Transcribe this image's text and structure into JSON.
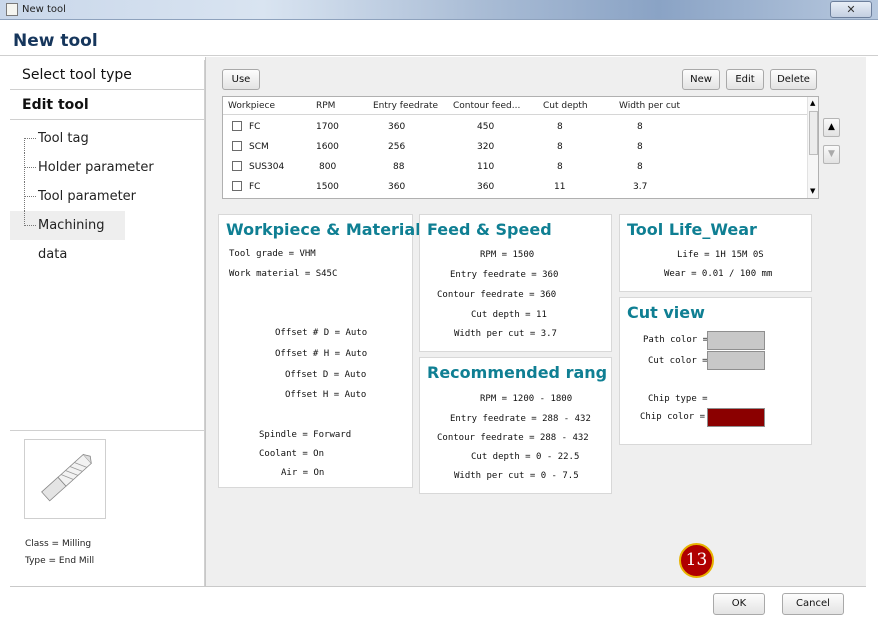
{
  "window": {
    "title": "New tool",
    "close_label": "✕"
  },
  "header": {
    "title": "New tool"
  },
  "sidebar": {
    "tabs": [
      {
        "label": "Select tool type"
      },
      {
        "label": "Edit tool"
      }
    ],
    "tree": [
      {
        "label": "Tool tag"
      },
      {
        "label": "Holder parameter"
      },
      {
        "label": "Tool parameter"
      },
      {
        "label": "Machining data"
      }
    ]
  },
  "tool_info": {
    "class": "Class = Milling",
    "type": "Type = End Mill"
  },
  "toolbar": {
    "use_label": "Use",
    "new_label": "New",
    "edit_label": "Edit",
    "delete_label": "Delete"
  },
  "table": {
    "columns": [
      "Workpiece",
      "RPM",
      "Entry feedrate",
      "Contour feed...",
      "Cut depth",
      "Width per cut"
    ],
    "rows": [
      [
        "FC",
        "1700",
        "360",
        "450",
        "8",
        "8"
      ],
      [
        "SCM",
        "1600",
        "256",
        "320",
        "8",
        "8"
      ],
      [
        "SUS304",
        "800",
        "88",
        "110",
        "8",
        "8"
      ],
      [
        "FC",
        "1500",
        "360",
        "360",
        "11",
        "3.7"
      ]
    ]
  },
  "workpiece_card": {
    "title": "Workpiece & Material",
    "tool_grade": "Tool grade = VHM",
    "work_material": "Work material = S45C",
    "offset_num_d": "Offset # D = Auto",
    "offset_num_h": "Offset # H = Auto",
    "offset_d": "Offset D = Auto",
    "offset_h": "Offset H = Auto",
    "spindle": "Spindle = Forward",
    "coolant": "Coolant = On",
    "air": "Air = On"
  },
  "feed_card": {
    "title": "Feed & Speed",
    "rpm": "RPM = 1500",
    "entry": "Entry feedrate = 360",
    "contour": "Contour feedrate = 360",
    "cut_depth": "Cut depth = 11",
    "width": "Width per cut = 3.7"
  },
  "recommended_card": {
    "title": "Recommended range",
    "rpm": "RPM = 1200 - 1800",
    "entry": "Entry feedrate = 288 - 432",
    "contour": "Contour feedrate = 288 - 432",
    "cut_depth": "Cut depth = 0 - 22.5",
    "width": "Width per cut = 0 - 7.5"
  },
  "life_card": {
    "title": "Tool Life_Wear",
    "life": "Life = 1H 15M 0S",
    "wear": "Wear = 0.01 / 100 mm"
  },
  "cut_view_card": {
    "title": "Cut view",
    "path_color_label": "Path color =",
    "cut_color_label": "Cut color =",
    "chip_type_label": "Chip type =",
    "chip_color_label": "Chip color =",
    "path_color": "#c8c8c8",
    "cut_color": "#c8c8c8",
    "chip_color": "#8b0000"
  },
  "badge": {
    "number": "13"
  },
  "footer": {
    "ok_label": "OK",
    "cancel_label": "Cancel"
  },
  "icons": {
    "up": "up-arrow-icon",
    "down": "down-arrow-icon"
  }
}
